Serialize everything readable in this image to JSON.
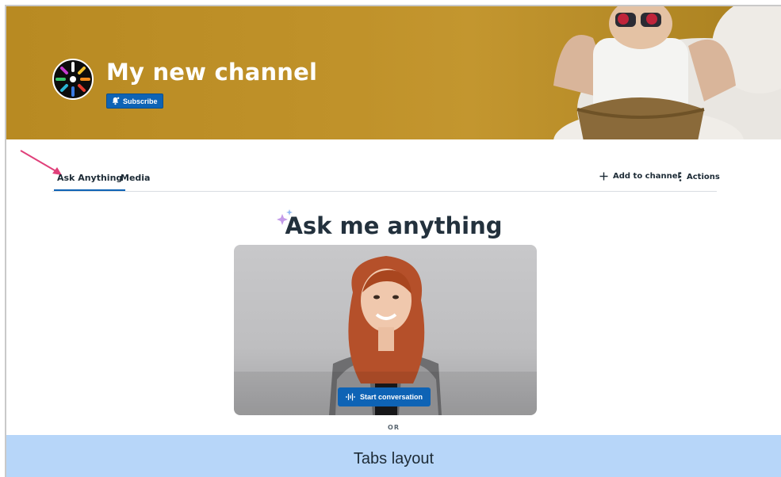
{
  "channel": {
    "title": "My new channel",
    "subscribe_label": "Subscribe"
  },
  "tabs": [
    {
      "label": "Ask Anything",
      "active": true
    },
    {
      "label": "Media",
      "active": false
    }
  ],
  "actions": {
    "add_to_channel": "Add to channel",
    "actions": "Actions"
  },
  "ask": {
    "title": "Ask me anything",
    "start_label": "Start conversation",
    "or_label": "OR"
  },
  "footer": {
    "caption": "Tabs layout"
  },
  "colors": {
    "accent": "#0e63b5",
    "banner": "#c0922a",
    "annotation_arrow": "#e0407a",
    "footer_band": "#b7d6f9"
  },
  "icons": [
    "channel-logo-icon",
    "bell-icon",
    "plus-icon",
    "kebab-icon",
    "sparkle-icon",
    "waveform-icon",
    "annotation-arrow-icon"
  ]
}
